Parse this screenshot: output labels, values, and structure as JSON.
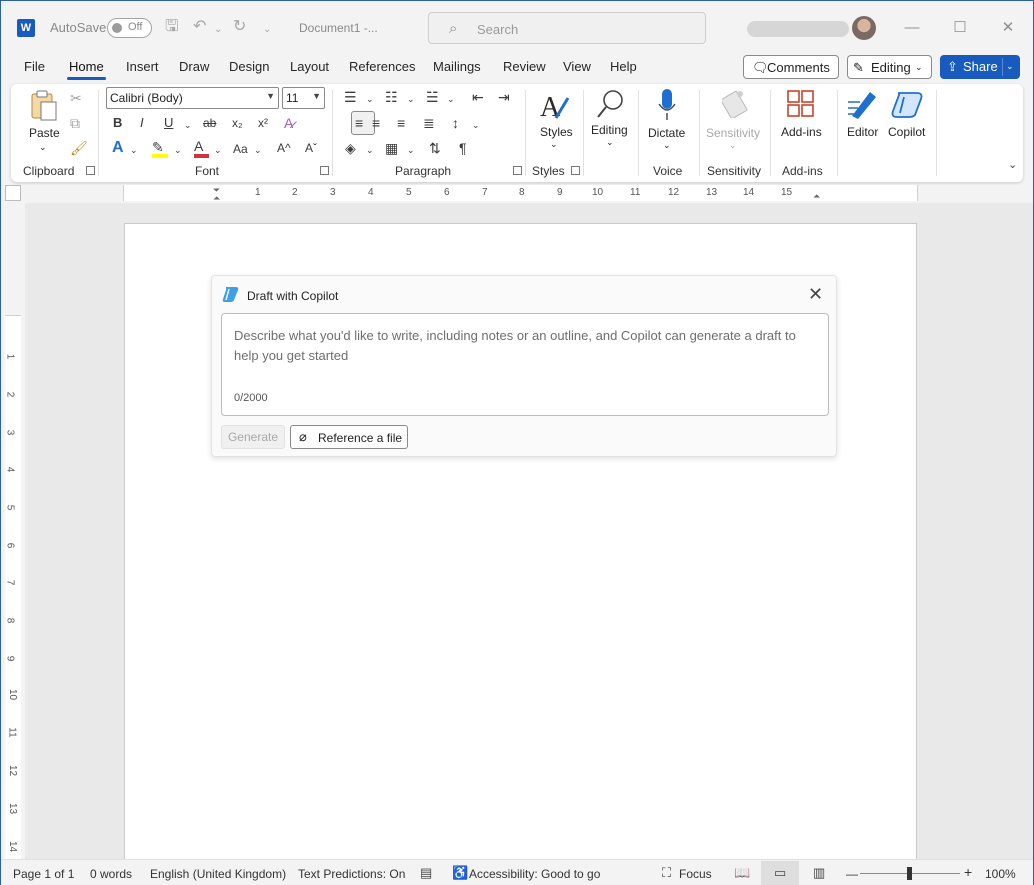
{
  "titlebar": {
    "app_logo": "W",
    "autosave_label": "AutoSave",
    "autosave_state": "Off",
    "doc_title": "Document1  -...",
    "search_placeholder": "Search",
    "window_buttons": [
      "—",
      "☐",
      "✕"
    ]
  },
  "tabs": [
    "File",
    "Home",
    "Insert",
    "Draw",
    "Design",
    "Layout",
    "References",
    "Mailings",
    "Review",
    "View",
    "Help"
  ],
  "active_tab": "Home",
  "header_buttons": {
    "comments": "Comments",
    "editing": "Editing",
    "share": "Share"
  },
  "ribbon": {
    "clipboard": {
      "paste": "Paste",
      "label": "Clipboard"
    },
    "font": {
      "name": "Calibri (Body)",
      "size": "11",
      "label": "Font",
      "bold": "B",
      "italic": "I",
      "underline": "U",
      "strike": "ab",
      "sub": "x₂",
      "sup": "x²",
      "grow": "A^",
      "shrink": "Aˇ",
      "case": "Aa"
    },
    "paragraph": {
      "label": "Paragraph",
      "pilcrow": "¶"
    },
    "styles": {
      "button": "Styles",
      "label": "Styles"
    },
    "editing": {
      "button": "Editing"
    },
    "voice": {
      "button": "Dictate",
      "label": "Voice"
    },
    "sensitivity": {
      "button": "Sensitivity",
      "label": "Sensitivity"
    },
    "addins": {
      "button": "Add-ins",
      "label": "Add-ins"
    },
    "editor": {
      "button": "Editor"
    },
    "copilot": {
      "button": "Copilot"
    }
  },
  "hruler_numbers": [
    "1",
    "2",
    "3",
    "4",
    "5",
    "6",
    "7",
    "8",
    "9",
    "10",
    "11",
    "12",
    "13",
    "14",
    "15"
  ],
  "vruler_numbers": [
    "1",
    "2",
    "3",
    "4",
    "5",
    "6",
    "7",
    "8",
    "9",
    "10",
    "11",
    "12",
    "13",
    "14"
  ],
  "copilot_panel": {
    "title": "Draft with Copilot",
    "placeholder": "Describe what you'd like to write, including notes or an outline, and Copilot can generate a draft to help you get started",
    "counter": "0/2000",
    "generate": "Generate",
    "reference": "Reference a file"
  },
  "statusbar": {
    "page": "Page 1 of 1",
    "words": "0 words",
    "language": "English (United Kingdom)",
    "predictions": "Text Predictions: On",
    "accessibility": "Accessibility: Good to go",
    "focus": "Focus",
    "zoom_minus": "—",
    "zoom_plus": "+",
    "zoom": "100%"
  },
  "colors": {
    "accent": "#185abd",
    "font_color_bar": "#d13438",
    "highlight_bar": "#ffff00"
  }
}
